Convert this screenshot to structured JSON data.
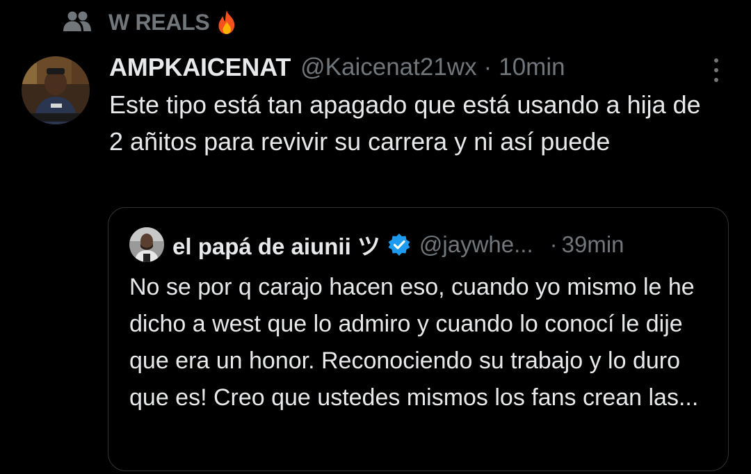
{
  "community": {
    "icon": "community-icon",
    "name": "W REALS",
    "emoji": "fire-emoji"
  },
  "tweet": {
    "display_name": "AMPKAICENAT",
    "handle": "@Kaicenat21wx",
    "separator": "·",
    "time": "10min",
    "text": "Este tipo está tan apagado que está usando a hija de 2 añitos para revivir su carrera y ni así puede"
  },
  "quoted_tweet": {
    "display_name": "el papá de aiunii ツ",
    "verified": true,
    "handle": "@jaywhe...",
    "separator": "·",
    "time": "39min",
    "text": "No se por q carajo hacen eso, cuando yo mismo le he dicho a west que lo admiro y cuando lo conocí le dije que era un honor. Reconociendo su trabajo y lo duro que es! Creo que ustedes mismos los fans crean las..."
  },
  "colors": {
    "background": "#000000",
    "primary_text": "#e7e9ea",
    "secondary_text": "#71767b",
    "border": "#2f3336",
    "verified_blue": "#1d9bf0"
  }
}
